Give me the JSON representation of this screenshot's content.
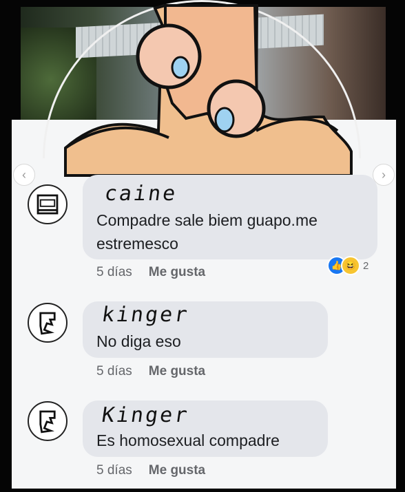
{
  "comments": [
    {
      "author": "caine",
      "text_line1": "Compadre sale biem guapo.me",
      "text_line2": "estremesco",
      "time": "5 días",
      "like_label": "Me gusta",
      "reactions_count": "2"
    },
    {
      "author": "kinger",
      "text_line1": "No diga eso",
      "time": "5 días",
      "like_label": "Me gusta"
    },
    {
      "author": "Kinger",
      "text_line1": "Es homosexual compadre",
      "time": "5 días",
      "like_label": "Me gusta"
    }
  ],
  "icons": {
    "prev": "chevron-left-icon",
    "next": "chevron-right-icon",
    "like_reaction": "thumbs-up-icon",
    "haha_reaction": "laughing-face-icon"
  },
  "colors": {
    "card_background": "#f5f6f7",
    "bubble": "#e4e6eb",
    "like_blue": "#1877f2",
    "haha_yellow": "#f7c531",
    "character_skin": "#f0bf8e",
    "eye_blue": "#9fd2f1"
  }
}
